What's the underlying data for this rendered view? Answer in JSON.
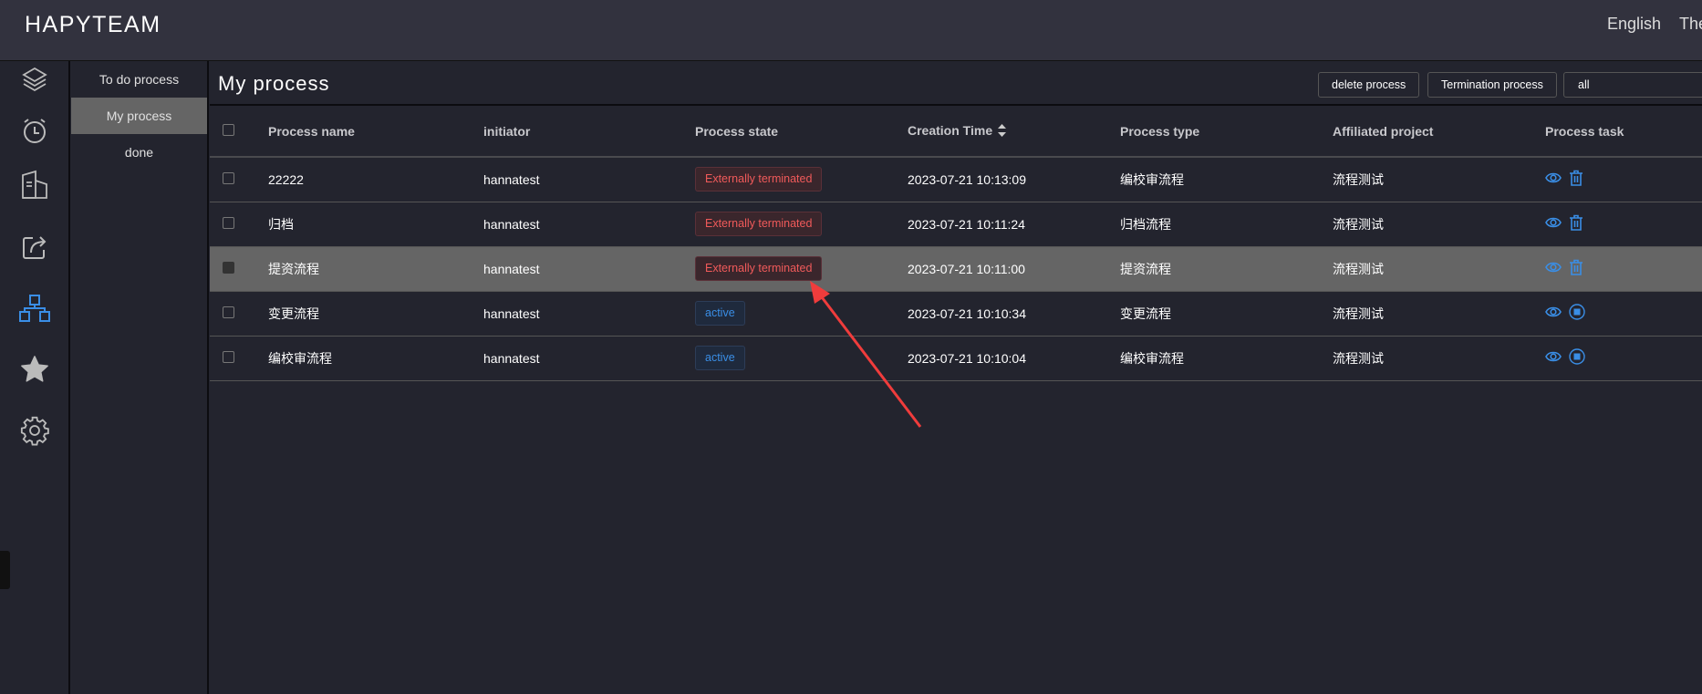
{
  "header": {
    "logo": "HAPYTEAM",
    "language": "English",
    "theme": "The"
  },
  "iconbar": [
    {
      "icon": "layers-icon"
    },
    {
      "icon": "alarm-clock-icon"
    },
    {
      "icon": "building-icon"
    },
    {
      "icon": "share-icon"
    },
    {
      "icon": "org-chart-icon",
      "active": true
    },
    {
      "icon": "star-icon"
    },
    {
      "icon": "gear-icon"
    }
  ],
  "submenu": {
    "items": [
      {
        "label": "To do process"
      },
      {
        "label": "My process",
        "active": true
      },
      {
        "label": "done"
      }
    ]
  },
  "main": {
    "title": "My process",
    "delete_label": "delete process",
    "terminate_label": "Termination process",
    "filter_value": "all"
  },
  "table": {
    "headers": [
      "Process name",
      "initiator",
      "Process state",
      "Creation Time",
      "Process type",
      "Affiliated project",
      "Process task"
    ],
    "rows": [
      {
        "name": "22222",
        "initiator": "hannatest",
        "state": "Externally terminated",
        "time": "2023-07-21 10:13:09",
        "type": "编校审流程",
        "project": "流程测试",
        "action": "delete"
      },
      {
        "name": "归档",
        "initiator": "hannatest",
        "state": "Externally terminated",
        "time": "2023-07-21 10:11:24",
        "type": "归档流程",
        "project": "流程测试",
        "action": "delete"
      },
      {
        "name": "提资流程",
        "initiator": "hannatest",
        "state": "Externally terminated",
        "time": "2023-07-21 10:11:00",
        "type": "提资流程",
        "project": "流程测试",
        "action": "delete",
        "highlighted": true
      },
      {
        "name": "变更流程",
        "initiator": "hannatest",
        "state": "active",
        "time": "2023-07-21 10:10:34",
        "type": "变更流程",
        "project": "流程测试",
        "action": "stop"
      },
      {
        "name": "编校审流程",
        "initiator": "hannatest",
        "state": "active",
        "time": "2023-07-21 10:10:04",
        "type": "编校审流程",
        "project": "流程测试",
        "action": "stop"
      }
    ]
  },
  "colors": {
    "accent": "#3a8ee6",
    "terminated": "#f05a5a",
    "annotation_arrow": "#f03c3c"
  }
}
